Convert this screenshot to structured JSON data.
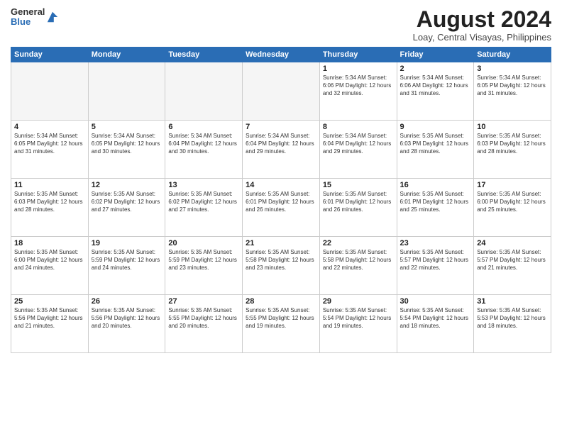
{
  "logo": {
    "general": "General",
    "blue": "Blue"
  },
  "title": "August 2024",
  "location": "Loay, Central Visayas, Philippines",
  "days_of_week": [
    "Sunday",
    "Monday",
    "Tuesday",
    "Wednesday",
    "Thursday",
    "Friday",
    "Saturday"
  ],
  "weeks": [
    [
      {
        "day": "",
        "info": ""
      },
      {
        "day": "",
        "info": ""
      },
      {
        "day": "",
        "info": ""
      },
      {
        "day": "",
        "info": ""
      },
      {
        "day": "1",
        "info": "Sunrise: 5:34 AM\nSunset: 6:06 PM\nDaylight: 12 hours\nand 32 minutes."
      },
      {
        "day": "2",
        "info": "Sunrise: 5:34 AM\nSunset: 6:06 AM\nDaylight: 12 hours\nand 31 minutes."
      },
      {
        "day": "3",
        "info": "Sunrise: 5:34 AM\nSunset: 6:05 PM\nDaylight: 12 hours\nand 31 minutes."
      }
    ],
    [
      {
        "day": "4",
        "info": "Sunrise: 5:34 AM\nSunset: 6:05 PM\nDaylight: 12 hours\nand 31 minutes."
      },
      {
        "day": "5",
        "info": "Sunrise: 5:34 AM\nSunset: 6:05 PM\nDaylight: 12 hours\nand 30 minutes."
      },
      {
        "day": "6",
        "info": "Sunrise: 5:34 AM\nSunset: 6:04 PM\nDaylight: 12 hours\nand 30 minutes."
      },
      {
        "day": "7",
        "info": "Sunrise: 5:34 AM\nSunset: 6:04 PM\nDaylight: 12 hours\nand 29 minutes."
      },
      {
        "day": "8",
        "info": "Sunrise: 5:34 AM\nSunset: 6:04 PM\nDaylight: 12 hours\nand 29 minutes."
      },
      {
        "day": "9",
        "info": "Sunrise: 5:35 AM\nSunset: 6:03 PM\nDaylight: 12 hours\nand 28 minutes."
      },
      {
        "day": "10",
        "info": "Sunrise: 5:35 AM\nSunset: 6:03 PM\nDaylight: 12 hours\nand 28 minutes."
      }
    ],
    [
      {
        "day": "11",
        "info": "Sunrise: 5:35 AM\nSunset: 6:03 PM\nDaylight: 12 hours\nand 28 minutes."
      },
      {
        "day": "12",
        "info": "Sunrise: 5:35 AM\nSunset: 6:02 PM\nDaylight: 12 hours\nand 27 minutes."
      },
      {
        "day": "13",
        "info": "Sunrise: 5:35 AM\nSunset: 6:02 PM\nDaylight: 12 hours\nand 27 minutes."
      },
      {
        "day": "14",
        "info": "Sunrise: 5:35 AM\nSunset: 6:01 PM\nDaylight: 12 hours\nand 26 minutes."
      },
      {
        "day": "15",
        "info": "Sunrise: 5:35 AM\nSunset: 6:01 PM\nDaylight: 12 hours\nand 26 minutes."
      },
      {
        "day": "16",
        "info": "Sunrise: 5:35 AM\nSunset: 6:01 PM\nDaylight: 12 hours\nand 25 minutes."
      },
      {
        "day": "17",
        "info": "Sunrise: 5:35 AM\nSunset: 6:00 PM\nDaylight: 12 hours\nand 25 minutes."
      }
    ],
    [
      {
        "day": "18",
        "info": "Sunrise: 5:35 AM\nSunset: 6:00 PM\nDaylight: 12 hours\nand 24 minutes."
      },
      {
        "day": "19",
        "info": "Sunrise: 5:35 AM\nSunset: 5:59 PM\nDaylight: 12 hours\nand 24 minutes."
      },
      {
        "day": "20",
        "info": "Sunrise: 5:35 AM\nSunset: 5:59 PM\nDaylight: 12 hours\nand 23 minutes."
      },
      {
        "day": "21",
        "info": "Sunrise: 5:35 AM\nSunset: 5:58 PM\nDaylight: 12 hours\nand 23 minutes."
      },
      {
        "day": "22",
        "info": "Sunrise: 5:35 AM\nSunset: 5:58 PM\nDaylight: 12 hours\nand 22 minutes."
      },
      {
        "day": "23",
        "info": "Sunrise: 5:35 AM\nSunset: 5:57 PM\nDaylight: 12 hours\nand 22 minutes."
      },
      {
        "day": "24",
        "info": "Sunrise: 5:35 AM\nSunset: 5:57 PM\nDaylight: 12 hours\nand 21 minutes."
      }
    ],
    [
      {
        "day": "25",
        "info": "Sunrise: 5:35 AM\nSunset: 5:56 PM\nDaylight: 12 hours\nand 21 minutes."
      },
      {
        "day": "26",
        "info": "Sunrise: 5:35 AM\nSunset: 5:56 PM\nDaylight: 12 hours\nand 20 minutes."
      },
      {
        "day": "27",
        "info": "Sunrise: 5:35 AM\nSunset: 5:55 PM\nDaylight: 12 hours\nand 20 minutes."
      },
      {
        "day": "28",
        "info": "Sunrise: 5:35 AM\nSunset: 5:55 PM\nDaylight: 12 hours\nand 19 minutes."
      },
      {
        "day": "29",
        "info": "Sunrise: 5:35 AM\nSunset: 5:54 PM\nDaylight: 12 hours\nand 19 minutes."
      },
      {
        "day": "30",
        "info": "Sunrise: 5:35 AM\nSunset: 5:54 PM\nDaylight: 12 hours\nand 18 minutes."
      },
      {
        "day": "31",
        "info": "Sunrise: 5:35 AM\nSunset: 5:53 PM\nDaylight: 12 hours\nand 18 minutes."
      }
    ]
  ]
}
